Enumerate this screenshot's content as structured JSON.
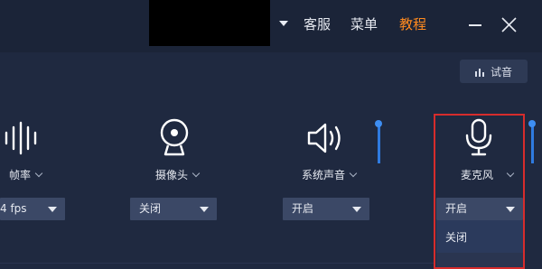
{
  "header": {
    "customer_service": "客服",
    "menu": "菜单",
    "tutorial": "教程"
  },
  "toolbar": {
    "test_audio": "试音"
  },
  "devices": [
    {
      "label": "帧率",
      "value": "4 fps",
      "icon": "waveform-icon"
    },
    {
      "label": "摄像头",
      "value": "关闭",
      "icon": "webcam-icon"
    },
    {
      "label": "系统声音",
      "value": "开启",
      "icon": "speaker-icon"
    },
    {
      "label": "麦克风",
      "value": "开启",
      "icon": "microphone-icon"
    }
  ],
  "microphone_dropdown": {
    "options": [
      "关闭"
    ]
  },
  "colors": {
    "accent": "#ff8a1f",
    "background": "#1f2940",
    "highlight_frame": "#d62c2c",
    "slider": "#2f7be0"
  }
}
